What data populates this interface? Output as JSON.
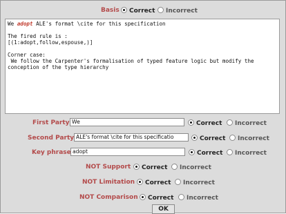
{
  "basis": {
    "label": "Basis",
    "options": [
      "Correct",
      "Incorrect"
    ],
    "selected": "Correct"
  },
  "text_area": {
    "line1_prefix": "We ",
    "line1_highlight": "adopt",
    "line1_suffix": " ALE's format \\cite for this specification",
    "fired_rule_label": "The fired rule is :",
    "fired_rule_value": "[(1:adopt,follow,espouse,)]",
    "corner_case_label": "Corner case:",
    "corner_case_text": " We follow the Carpenter's formalisation of typed feature logic but modify the conception of the type hierarchy"
  },
  "first_party": {
    "label": "First Party",
    "value": "We",
    "options": [
      "Correct",
      "Incorrect"
    ],
    "selected": "Correct"
  },
  "second_party": {
    "label": "Second Party",
    "value": "ALE's format \\cite for this specificatio",
    "options": [
      "Correct",
      "Incorrect"
    ],
    "selected": "Correct"
  },
  "key_phrase": {
    "label": "Key phrase",
    "value": "adopt",
    "options": [
      "Correct",
      "Incorrect"
    ],
    "selected": "Correct"
  },
  "not_support": {
    "label": "NOT Support",
    "options": [
      "Correct",
      "Incorrect"
    ],
    "selected": "Correct"
  },
  "not_limitation": {
    "label": "NOT Limitation",
    "options": [
      "Correct",
      "Incorrect"
    ],
    "selected": "Correct"
  },
  "not_comparison": {
    "label": "NOT Comparison",
    "options": [
      "Correct",
      "Incorrect"
    ],
    "selected": "Correct"
  },
  "ok_button": "OK",
  "colors": {
    "label_red": "#b34a4a",
    "panel": "#dcdcdc",
    "highlight": "#c0392b"
  }
}
